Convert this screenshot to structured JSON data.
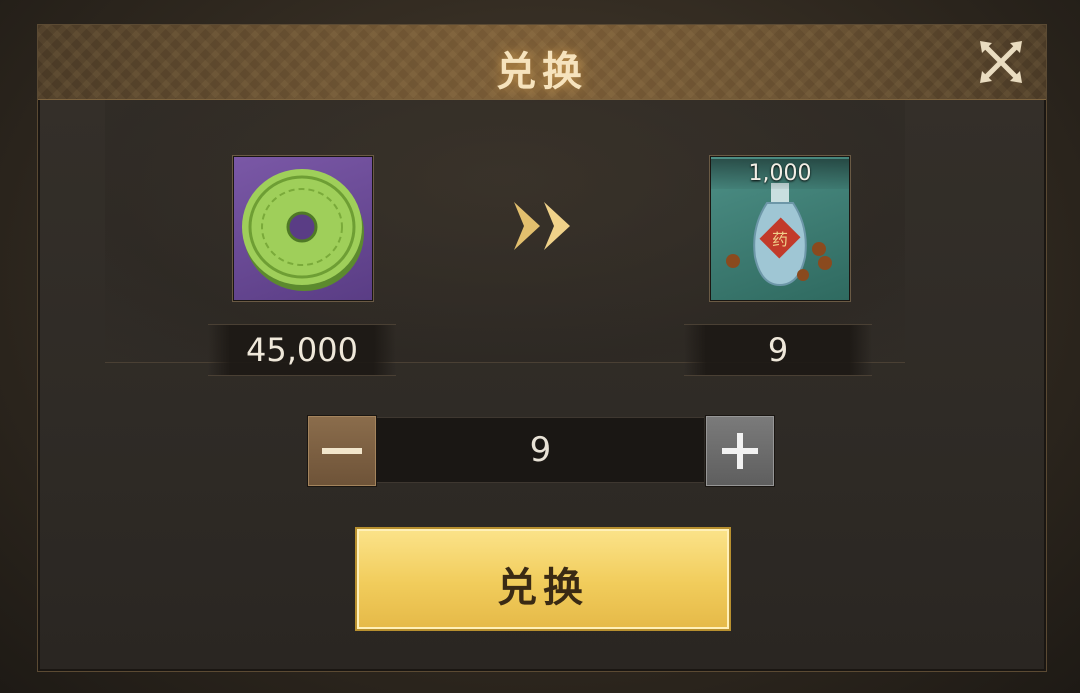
{
  "dialog": {
    "title": "兑换",
    "close_icon": "close-x-icon"
  },
  "exchange": {
    "source": {
      "icon": "jade-disc-coin-icon",
      "amount": "45,000"
    },
    "direction_icon": "double-chevron-right-icon",
    "target": {
      "icon": "medicine-bottle-icon",
      "stack_count": "1,000",
      "amount": "9"
    }
  },
  "quantity": {
    "value": "9",
    "decrease_icon": "minus-icon",
    "increase_icon": "plus-icon"
  },
  "confirm_button": {
    "label": "兑换"
  },
  "colors": {
    "accent_gold": "#f1cc5b",
    "title_text": "#f6e3bd",
    "source_bg": "#6a4a96",
    "target_bg": "#3f7d74"
  }
}
